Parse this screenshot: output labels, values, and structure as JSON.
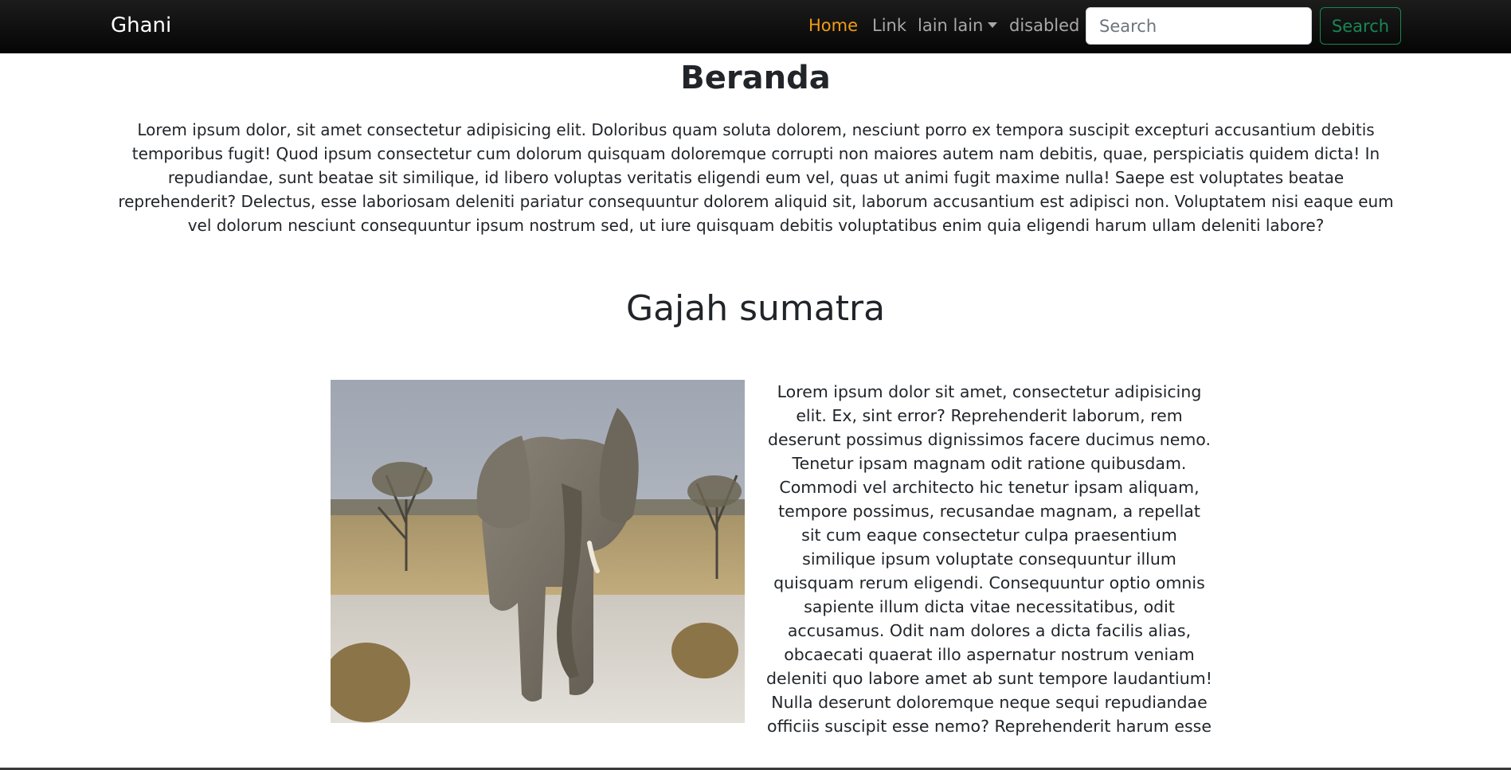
{
  "navbar": {
    "brand": "Ghani",
    "links": [
      {
        "label": "Home",
        "active": true
      },
      {
        "label": "Link",
        "active": false
      },
      {
        "label": "lain lain",
        "dropdown": true
      },
      {
        "label": "disabled",
        "disabled": true
      }
    ],
    "search_placeholder": "Search",
    "search_button": "Search"
  },
  "main": {
    "title": "Beranda",
    "intro": "Lorem ipsum dolor, sit amet consectetur adipisicing elit. Doloribus quam soluta dolorem, nesciunt porro ex tempora suscipit excepturi accusantium debitis temporibus fugit! Quod ipsum consectetur cum dolorum quisquam doloremque corrupti non maiores autem nam debitis, quae, perspiciatis quidem dicta! In repudiandae, sunt beatae sit similique, id libero voluptas veritatis eligendi eum vel, quas ut animi fugit maxime nulla! Saepe est voluptates beatae reprehenderit? Delectus, esse laboriosam deleniti pariatur consequuntur dolorem aliquid sit, laborum accusantium est adipisci non. Voluptatem nisi eaque eum vel dolorum nesciunt consequuntur ipsum nostrum sed, ut iure quisquam debitis voluptatibus enim quia eligendi harum ullam deleniti labore?",
    "section_title": "Gajah sumatra",
    "section_text": "Lorem ipsum dolor sit amet, consectetur adipisicing elit. Ex, sint error? Reprehenderit laborum, rem deserunt possimus dignissimos facere ducimus nemo. Tenetur ipsam magnam odit ratione quibusdam. Commodi vel architecto hic tenetur ipsam aliquam, tempore possimus, recusandae magnam, a repellat sit cum eaque consectetur culpa praesentium similique ipsum voluptate consequuntur illum quisquam rerum eligendi. Consequuntur optio omnis sapiente illum dicta vitae necessitatibus, odit accusamus. Odit nam dolores a dicta facilis alias, obcaecati quaerat illo aspernatur nostrum veniam deleniti quo labore amet ab sunt tempore laudantium! Nulla deserunt doloremque neque sequi repudiandae officiis suscipit esse nemo? Reprehenderit harum esse"
  },
  "colors": {
    "navbar_bg": "#0a0a0a",
    "active_link": "#f39c12",
    "link": "#a8a8a8",
    "search_button": "#198754"
  }
}
